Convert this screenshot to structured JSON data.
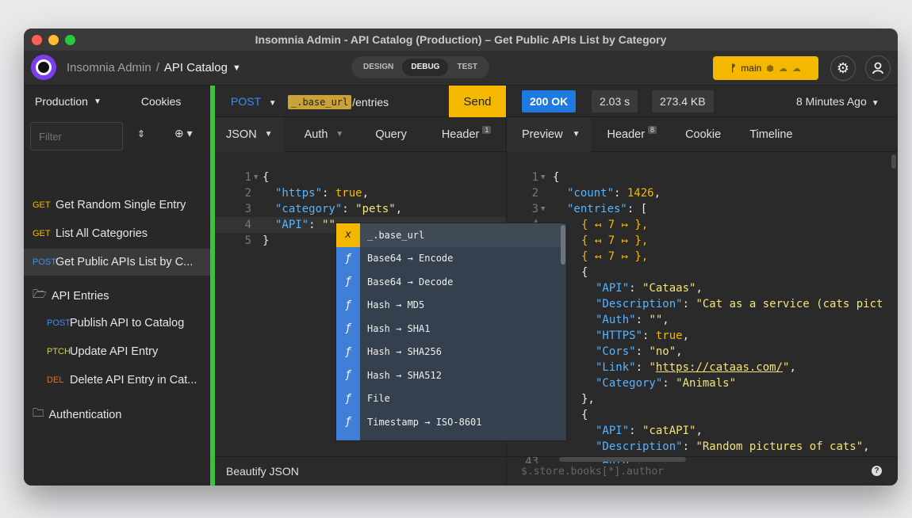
{
  "window": {
    "title": "Insomnia Admin - API Catalog (Production) – Get Public APIs List by Category"
  },
  "header": {
    "breadcrumb_root": "Insomnia Admin",
    "breadcrumb_sep": "/",
    "breadcrumb_current": "API Catalog",
    "modes": [
      "DESIGN",
      "DEBUG",
      "TEST"
    ],
    "active_mode": "DEBUG",
    "branch": "main"
  },
  "sidebar": {
    "environment": "Production",
    "cookies": "Cookies",
    "filter_placeholder": "Filter",
    "items": [
      {
        "method": "GET",
        "label": "Get Random Single Entry",
        "color": "#f5b800"
      },
      {
        "method": "GET",
        "label": "List All Categories",
        "color": "#f5b800"
      },
      {
        "method": "POST",
        "label": "Get Public APIs List by C...",
        "color": "#3d8ef0"
      }
    ],
    "folders": [
      "API Entries",
      "Authentication"
    ],
    "folder_items": [
      {
        "method": "POST",
        "label": "Publish API to Catalog",
        "color": "#3d8ef0"
      },
      {
        "method": "PTCH",
        "label": "Update API Entry",
        "color": "#d6d35a"
      },
      {
        "method": "DEL",
        "label": "Delete API Entry in Cat...",
        "color": "#e06c2c"
      }
    ]
  },
  "request": {
    "method": "POST",
    "url_tag": "_.base_url",
    "url_path": "/entries",
    "send": "Send",
    "tabs": [
      "JSON",
      "Auth",
      "Query",
      "Header"
    ],
    "header_count": "1",
    "footer": "Beautify JSON",
    "code": {
      "l1": "{",
      "l2k": "\"https\"",
      "l2v": "true",
      "l3k": "\"category\"",
      "l3v": "\"pets\"",
      "l4k": "\"API\"",
      "l4v": "\"\"",
      "l5": "}"
    },
    "line_numbers": [
      "1",
      "2",
      "3",
      "4",
      "5"
    ]
  },
  "autocomplete": {
    "items": [
      {
        "icon": "x",
        "label": "_.base_url"
      },
      {
        "icon": "ƒ",
        "label": "Base64 → Encode"
      },
      {
        "icon": "ƒ",
        "label": "Base64 → Decode"
      },
      {
        "icon": "ƒ",
        "label": "Hash → MD5"
      },
      {
        "icon": "ƒ",
        "label": "Hash → SHA1"
      },
      {
        "icon": "ƒ",
        "label": "Hash → SHA256"
      },
      {
        "icon": "ƒ",
        "label": "Hash → SHA512"
      },
      {
        "icon": "ƒ",
        "label": "File"
      },
      {
        "icon": "ƒ",
        "label": "Timestamp → ISO-8601"
      }
    ]
  },
  "response": {
    "status": "200 OK",
    "time": "2.03 s",
    "size": "273.4 KB",
    "age": "8 Minutes Ago",
    "tabs": [
      "Preview",
      "Header",
      "Cookie",
      "Timeline"
    ],
    "header_count": "8",
    "filter_placeholder": "$.store.books[*].author",
    "line_numbers": [
      "1",
      "2",
      "3",
      "4",
      "43"
    ],
    "count_key": "\"count\"",
    "count_val": "1426",
    "entries_key": "\"entries\"",
    "collapsed": "{ ↤ 7 ↦ },",
    "e1": {
      "API": "\"Cataas\"",
      "Description": "\"Cat as a service (cats pict",
      "Auth": "\"\"",
      "HTTPS": "true",
      "Cors": "\"no\"",
      "Link": "https://cataas.com/",
      "Category": "\"Animals\""
    },
    "e2": {
      "API": "\"catAPI\"",
      "Description": "\"Random pictures of cats\"",
      "Auth": "\"\""
    },
    "keys": {
      "API": "\"API\"",
      "Description": "\"Description\"",
      "Auth": "\"Auth\"",
      "HTTPS": "\"HTTPS\"",
      "Cors": "\"Cors\"",
      "Link": "\"Link\"",
      "Category": "\"Category\""
    }
  },
  "colors": {
    "accent": "#f5b800",
    "brand": "#7d3cf0",
    "post": "#3d8ef0",
    "active_bar": "#3cc13c",
    "status_ok": "#1f7ae0"
  }
}
